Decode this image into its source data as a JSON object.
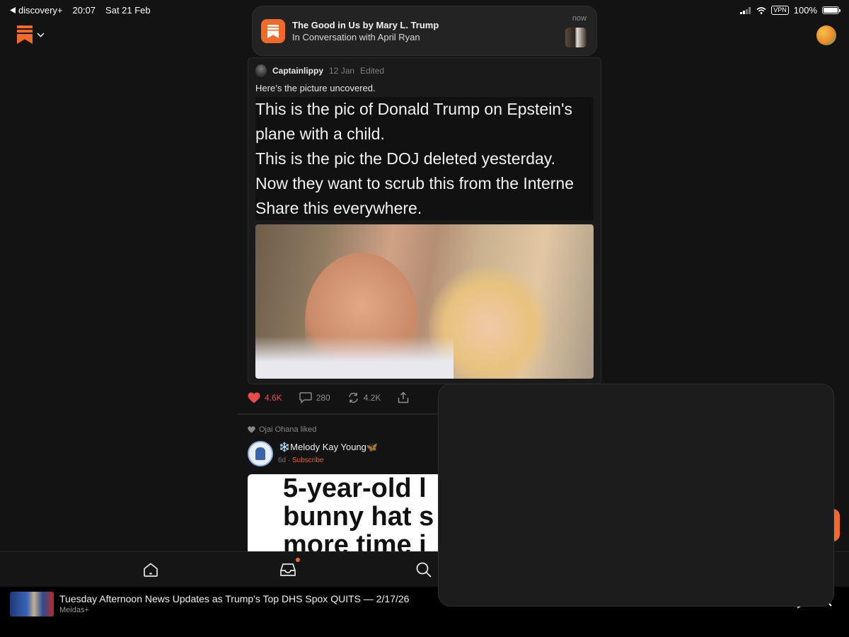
{
  "status_bar": {
    "back_app": "discovery+",
    "time": "20:07",
    "date": "Sat 21 Feb",
    "vpn": "VPN",
    "battery": "100%"
  },
  "notification": {
    "title": "The Good in Us by Mary L. Trump",
    "subtitle": "In Conversation with April Ryan",
    "time": "now"
  },
  "post": {
    "author": "Captainlippy",
    "date": "12 Jan",
    "edited": "Edited",
    "text": "Here’s the picture uncovered.",
    "quote_lines": [
      "This is the pic of Donald Trump on Epstein's",
      "plane with a child.",
      "This is the pic the DOJ deleted yesterday.",
      "Now they want to scrub this from the Interne",
      "Share this everywhere."
    ],
    "likes": "4.6K",
    "comments": "280",
    "restacks": "4.2K"
  },
  "post2": {
    "liked_by": "Ojai Ohana liked",
    "author": "❄️Melody Kay Young🦋",
    "age": "6d",
    "subscribe": "Subscribe",
    "headline_lines": [
      "5-year-old l",
      "bunny hat s",
      "more time i"
    ]
  },
  "now_playing": {
    "title": "Tuesday Afternoon News Updates as Trump's Top DHS Spox QUITS — 2/17/26",
    "source": "Meidas+"
  },
  "colors": {
    "accent": "#f06a2a",
    "like": "#e94b4b",
    "background": "#131313"
  },
  "icons": {
    "back": "back-arrow-icon",
    "logo": "substack-bookmark-icon",
    "home": "home-icon",
    "inbox": "inbox-icon",
    "search": "search-icon",
    "like": "heart-icon",
    "comment": "comment-icon",
    "restack": "restack-icon",
    "share": "share-icon",
    "close": "close-icon"
  }
}
